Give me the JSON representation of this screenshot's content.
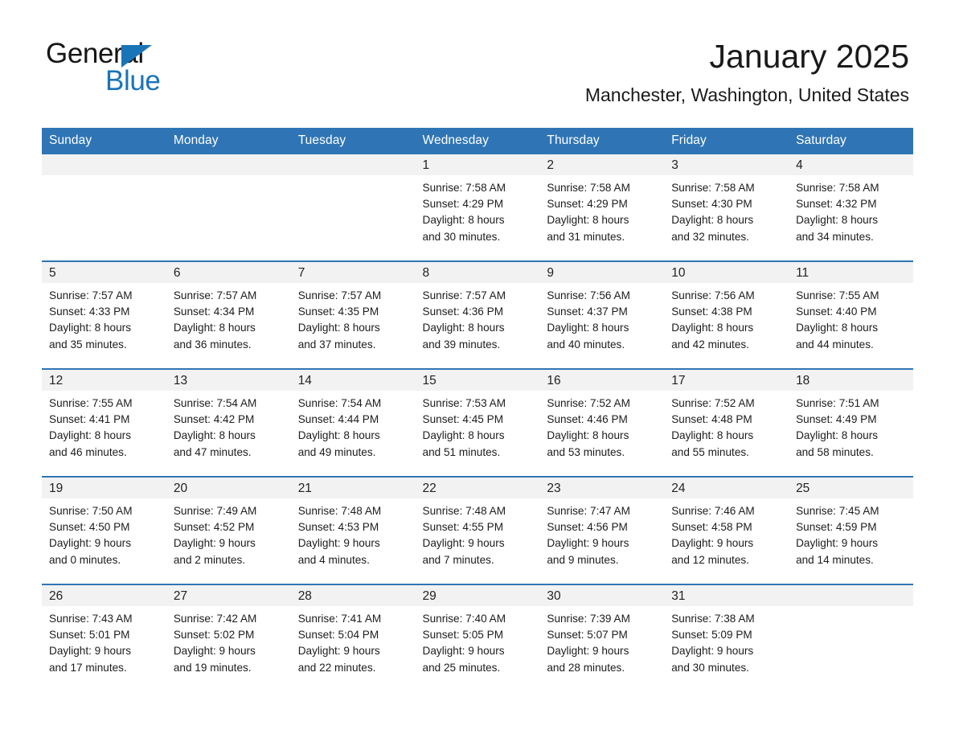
{
  "brand": {
    "word_one": "General",
    "word_two": "Blue",
    "triangle_icon": "brand-triangle-icon",
    "blue": "#1a74b8"
  },
  "header": {
    "month_title": "January 2025",
    "location": "Manchester, Washington, United States"
  },
  "theme": {
    "header_blue": "#2f75b5",
    "daynum_band": "#f2f2f2",
    "text": "#1c1c1c"
  },
  "weekday_headers": [
    "Sunday",
    "Monday",
    "Tuesday",
    "Wednesday",
    "Thursday",
    "Friday",
    "Saturday"
  ],
  "weeks": [
    [
      {
        "day": "",
        "sunrise": "",
        "sunset": "",
        "daylight_line1": "",
        "daylight_line2": ""
      },
      {
        "day": "",
        "sunrise": "",
        "sunset": "",
        "daylight_line1": "",
        "daylight_line2": ""
      },
      {
        "day": "",
        "sunrise": "",
        "sunset": "",
        "daylight_line1": "",
        "daylight_line2": ""
      },
      {
        "day": "1",
        "sunrise": "Sunrise: 7:58 AM",
        "sunset": "Sunset: 4:29 PM",
        "daylight_line1": "Daylight: 8 hours",
        "daylight_line2": "and 30 minutes."
      },
      {
        "day": "2",
        "sunrise": "Sunrise: 7:58 AM",
        "sunset": "Sunset: 4:29 PM",
        "daylight_line1": "Daylight: 8 hours",
        "daylight_line2": "and 31 minutes."
      },
      {
        "day": "3",
        "sunrise": "Sunrise: 7:58 AM",
        "sunset": "Sunset: 4:30 PM",
        "daylight_line1": "Daylight: 8 hours",
        "daylight_line2": "and 32 minutes."
      },
      {
        "day": "4",
        "sunrise": "Sunrise: 7:58 AM",
        "sunset": "Sunset: 4:32 PM",
        "daylight_line1": "Daylight: 8 hours",
        "daylight_line2": "and 34 minutes."
      }
    ],
    [
      {
        "day": "5",
        "sunrise": "Sunrise: 7:57 AM",
        "sunset": "Sunset: 4:33 PM",
        "daylight_line1": "Daylight: 8 hours",
        "daylight_line2": "and 35 minutes."
      },
      {
        "day": "6",
        "sunrise": "Sunrise: 7:57 AM",
        "sunset": "Sunset: 4:34 PM",
        "daylight_line1": "Daylight: 8 hours",
        "daylight_line2": "and 36 minutes."
      },
      {
        "day": "7",
        "sunrise": "Sunrise: 7:57 AM",
        "sunset": "Sunset: 4:35 PM",
        "daylight_line1": "Daylight: 8 hours",
        "daylight_line2": "and 37 minutes."
      },
      {
        "day": "8",
        "sunrise": "Sunrise: 7:57 AM",
        "sunset": "Sunset: 4:36 PM",
        "daylight_line1": "Daylight: 8 hours",
        "daylight_line2": "and 39 minutes."
      },
      {
        "day": "9",
        "sunrise": "Sunrise: 7:56 AM",
        "sunset": "Sunset: 4:37 PM",
        "daylight_line1": "Daylight: 8 hours",
        "daylight_line2": "and 40 minutes."
      },
      {
        "day": "10",
        "sunrise": "Sunrise: 7:56 AM",
        "sunset": "Sunset: 4:38 PM",
        "daylight_line1": "Daylight: 8 hours",
        "daylight_line2": "and 42 minutes."
      },
      {
        "day": "11",
        "sunrise": "Sunrise: 7:55 AM",
        "sunset": "Sunset: 4:40 PM",
        "daylight_line1": "Daylight: 8 hours",
        "daylight_line2": "and 44 minutes."
      }
    ],
    [
      {
        "day": "12",
        "sunrise": "Sunrise: 7:55 AM",
        "sunset": "Sunset: 4:41 PM",
        "daylight_line1": "Daylight: 8 hours",
        "daylight_line2": "and 46 minutes."
      },
      {
        "day": "13",
        "sunrise": "Sunrise: 7:54 AM",
        "sunset": "Sunset: 4:42 PM",
        "daylight_line1": "Daylight: 8 hours",
        "daylight_line2": "and 47 minutes."
      },
      {
        "day": "14",
        "sunrise": "Sunrise: 7:54 AM",
        "sunset": "Sunset: 4:44 PM",
        "daylight_line1": "Daylight: 8 hours",
        "daylight_line2": "and 49 minutes."
      },
      {
        "day": "15",
        "sunrise": "Sunrise: 7:53 AM",
        "sunset": "Sunset: 4:45 PM",
        "daylight_line1": "Daylight: 8 hours",
        "daylight_line2": "and 51 minutes."
      },
      {
        "day": "16",
        "sunrise": "Sunrise: 7:52 AM",
        "sunset": "Sunset: 4:46 PM",
        "daylight_line1": "Daylight: 8 hours",
        "daylight_line2": "and 53 minutes."
      },
      {
        "day": "17",
        "sunrise": "Sunrise: 7:52 AM",
        "sunset": "Sunset: 4:48 PM",
        "daylight_line1": "Daylight: 8 hours",
        "daylight_line2": "and 55 minutes."
      },
      {
        "day": "18",
        "sunrise": "Sunrise: 7:51 AM",
        "sunset": "Sunset: 4:49 PM",
        "daylight_line1": "Daylight: 8 hours",
        "daylight_line2": "and 58 minutes."
      }
    ],
    [
      {
        "day": "19",
        "sunrise": "Sunrise: 7:50 AM",
        "sunset": "Sunset: 4:50 PM",
        "daylight_line1": "Daylight: 9 hours",
        "daylight_line2": "and 0 minutes."
      },
      {
        "day": "20",
        "sunrise": "Sunrise: 7:49 AM",
        "sunset": "Sunset: 4:52 PM",
        "daylight_line1": "Daylight: 9 hours",
        "daylight_line2": "and 2 minutes."
      },
      {
        "day": "21",
        "sunrise": "Sunrise: 7:48 AM",
        "sunset": "Sunset: 4:53 PM",
        "daylight_line1": "Daylight: 9 hours",
        "daylight_line2": "and 4 minutes."
      },
      {
        "day": "22",
        "sunrise": "Sunrise: 7:48 AM",
        "sunset": "Sunset: 4:55 PM",
        "daylight_line1": "Daylight: 9 hours",
        "daylight_line2": "and 7 minutes."
      },
      {
        "day": "23",
        "sunrise": "Sunrise: 7:47 AM",
        "sunset": "Sunset: 4:56 PM",
        "daylight_line1": "Daylight: 9 hours",
        "daylight_line2": "and 9 minutes."
      },
      {
        "day": "24",
        "sunrise": "Sunrise: 7:46 AM",
        "sunset": "Sunset: 4:58 PM",
        "daylight_line1": "Daylight: 9 hours",
        "daylight_line2": "and 12 minutes."
      },
      {
        "day": "25",
        "sunrise": "Sunrise: 7:45 AM",
        "sunset": "Sunset: 4:59 PM",
        "daylight_line1": "Daylight: 9 hours",
        "daylight_line2": "and 14 minutes."
      }
    ],
    [
      {
        "day": "26",
        "sunrise": "Sunrise: 7:43 AM",
        "sunset": "Sunset: 5:01 PM",
        "daylight_line1": "Daylight: 9 hours",
        "daylight_line2": "and 17 minutes."
      },
      {
        "day": "27",
        "sunrise": "Sunrise: 7:42 AM",
        "sunset": "Sunset: 5:02 PM",
        "daylight_line1": "Daylight: 9 hours",
        "daylight_line2": "and 19 minutes."
      },
      {
        "day": "28",
        "sunrise": "Sunrise: 7:41 AM",
        "sunset": "Sunset: 5:04 PM",
        "daylight_line1": "Daylight: 9 hours",
        "daylight_line2": "and 22 minutes."
      },
      {
        "day": "29",
        "sunrise": "Sunrise: 7:40 AM",
        "sunset": "Sunset: 5:05 PM",
        "daylight_line1": "Daylight: 9 hours",
        "daylight_line2": "and 25 minutes."
      },
      {
        "day": "30",
        "sunrise": "Sunrise: 7:39 AM",
        "sunset": "Sunset: 5:07 PM",
        "daylight_line1": "Daylight: 9 hours",
        "daylight_line2": "and 28 minutes."
      },
      {
        "day": "31",
        "sunrise": "Sunrise: 7:38 AM",
        "sunset": "Sunset: 5:09 PM",
        "daylight_line1": "Daylight: 9 hours",
        "daylight_line2": "and 30 minutes."
      },
      {
        "day": "",
        "sunrise": "",
        "sunset": "",
        "daylight_line1": "",
        "daylight_line2": ""
      }
    ]
  ]
}
